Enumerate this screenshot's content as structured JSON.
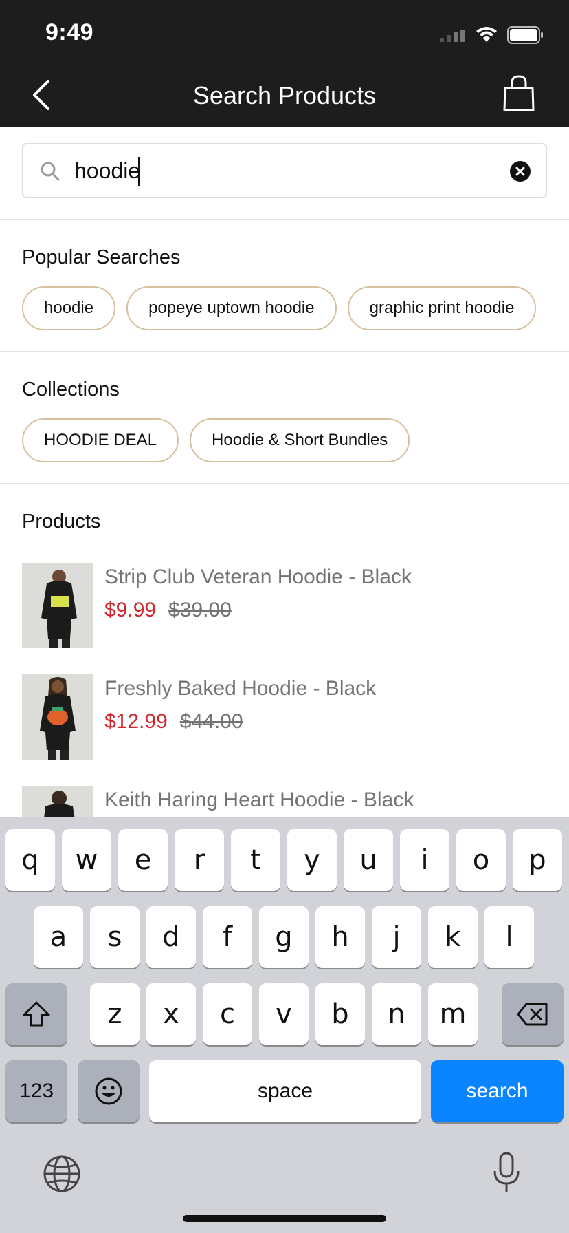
{
  "status": {
    "time": "9:49"
  },
  "nav": {
    "title": "Search Products"
  },
  "search": {
    "value": "hoodie"
  },
  "popular": {
    "title": "Popular Searches",
    "chips": [
      "hoodie",
      "popeye uptown hoodie",
      "graphic print hoodie"
    ]
  },
  "collections": {
    "title": "Collections",
    "chips": [
      "HOODIE DEAL",
      "Hoodie & Short Bundles"
    ]
  },
  "products": {
    "title": "Products",
    "items": [
      {
        "name": "Strip Club Veteran Hoodie - Black",
        "sale_price": "$9.99",
        "original_price": "$39.00",
        "graphic_color": "#d8e04a"
      },
      {
        "name": "Freshly Baked Hoodie - Black",
        "sale_price": "$12.99",
        "original_price": "$44.00",
        "graphic_color": "#e0622a"
      },
      {
        "name": "Keith Haring Heart Hoodie - Black"
      }
    ]
  },
  "keyboard": {
    "row1": [
      "q",
      "w",
      "e",
      "r",
      "t",
      "y",
      "u",
      "i",
      "o",
      "p"
    ],
    "row2": [
      "a",
      "s",
      "d",
      "f",
      "g",
      "h",
      "j",
      "k",
      "l"
    ],
    "row3": [
      "z",
      "x",
      "c",
      "v",
      "b",
      "n",
      "m"
    ],
    "numbers_label": "123",
    "space_label": "space",
    "search_label": "search"
  },
  "colors": {
    "header_bg": "#1d1d1d",
    "chip_border": "#d6c19e",
    "sale_price": "#d0262c",
    "search_key": "#0a84ff"
  }
}
